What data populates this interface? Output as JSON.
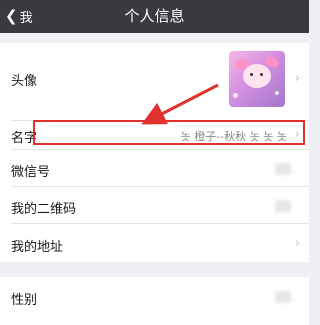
{
  "navbar": {
    "back_label": "我",
    "title": "个人信息"
  },
  "rows": {
    "avatar": {
      "label": "头像"
    },
    "name": {
      "label": "名字",
      "value": "놋 橙子--秋秋 놋 놋 놋"
    },
    "wechat_id": {
      "label": "微信号"
    },
    "qr_code": {
      "label": "我的二维码"
    },
    "address": {
      "label": "我的地址"
    },
    "gender": {
      "label": "性别"
    }
  },
  "annotation": {
    "highlight_color": "#e0312f",
    "arrow_color": "#e0312f"
  },
  "colors": {
    "navbar_bg": "#393a3f",
    "page_bg": "#efeff4"
  }
}
